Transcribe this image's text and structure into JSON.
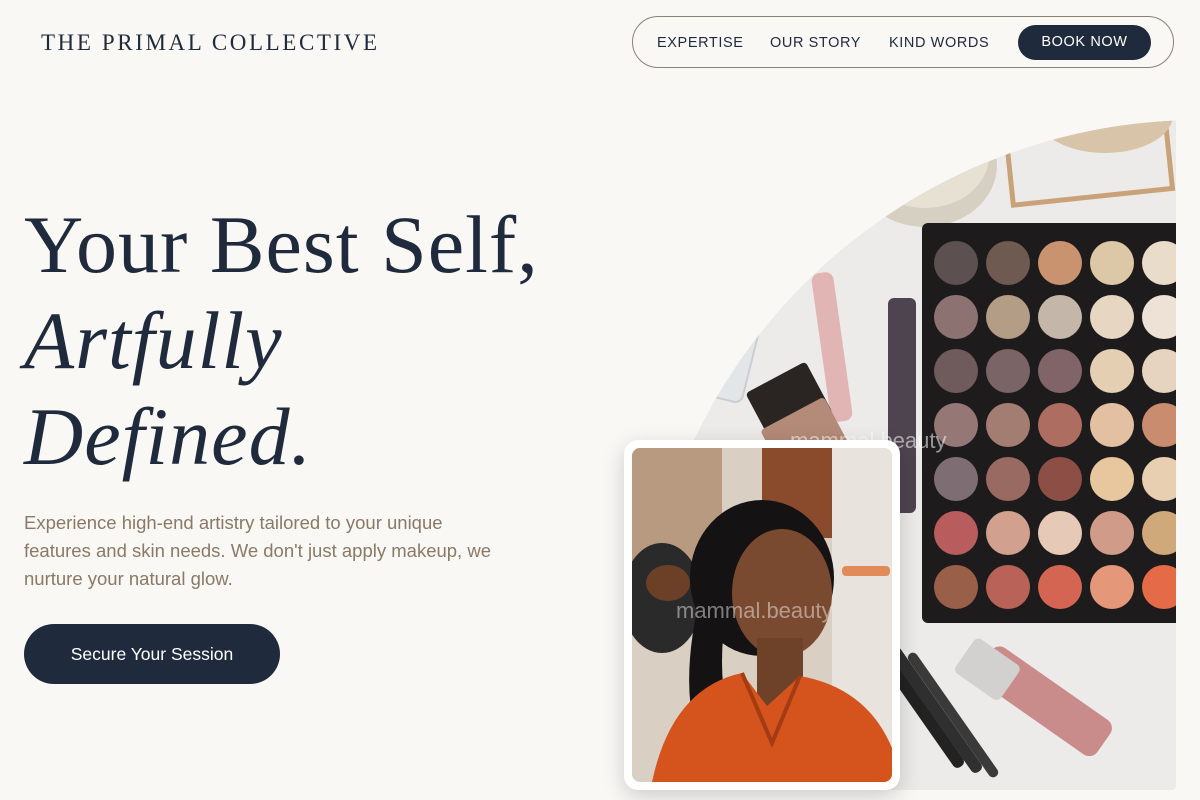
{
  "brand": {
    "name": "THE PRIMAL COLLECTIVE"
  },
  "nav": {
    "links": [
      "EXPERTISE",
      "OUR STORY",
      "KIND WORDS"
    ],
    "cta_label": "BOOK NOW"
  },
  "hero": {
    "headline_line1": "Your Best Self,",
    "headline_line2": "Artfully",
    "headline_line3": "Defined.",
    "subtitle": "Experience high-end artistry tailored to your unique features and skin needs. We don't just apply makeup, we nurture your natural glow.",
    "cta_label": "Secure Your Session"
  },
  "images": {
    "main_watermark": "mammal.beauty",
    "inset_watermark": "mammal.beauty"
  },
  "colors": {
    "background": "#f9f8f5",
    "navy": "#1f2a3c",
    "subtitle_text": "#8a7966"
  }
}
